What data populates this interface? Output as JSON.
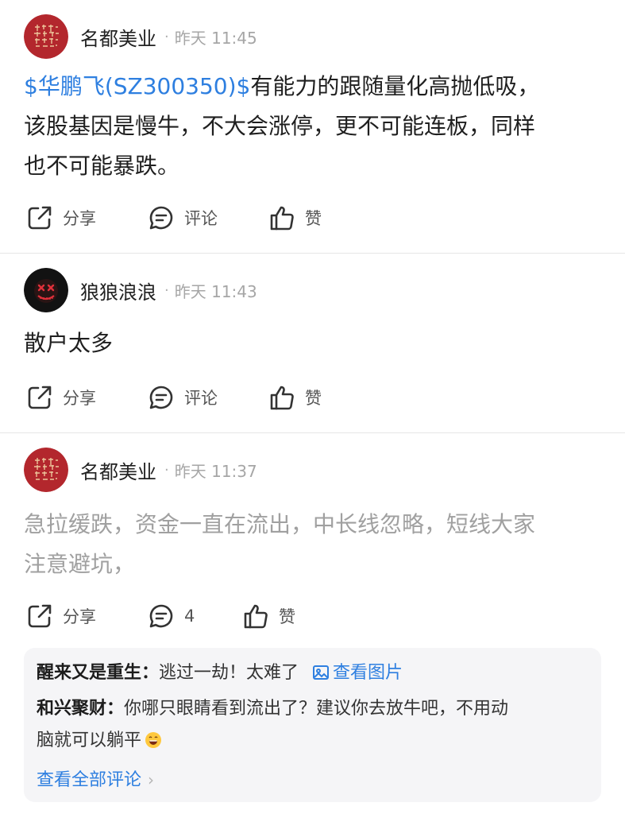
{
  "posts": [
    {
      "user": "名都美业",
      "dot": "·",
      "time": "昨天 11:45",
      "stock": "$华鹏飞(SZ300350)$",
      "text_line1": "有能力的跟随量化高抛低吸，",
      "text_line2": "该股基因是慢牛，不大会涨停，更不可能连板，同样",
      "text_line3": "也不可能暴跌。",
      "share_label": "分享",
      "comment_label": "评论",
      "like_label": "赞"
    },
    {
      "user": "狼狼浪浪",
      "dot": "·",
      "time": "昨天 11:43",
      "text_line1": "散户太多",
      "share_label": "分享",
      "comment_label": "评论",
      "like_label": "赞"
    },
    {
      "user": "名都美业",
      "dot": "·",
      "time": "昨天 11:37",
      "text_line1": "急拉缓跌，资金一直在流出，中长线忽略，短线大家",
      "text_line2": "注意避坑，",
      "share_label": "分享",
      "comment_count": "4",
      "like_label": "赞",
      "replies": [
        {
          "name": "醒来又是重生：",
          "text": "逃过一劫！太难了",
          "link": "查看图片"
        },
        {
          "name": "和兴聚财：",
          "text_line1": "你哪只眼睛看到流出了？建议你去放牛吧，不用动",
          "text_line2": "脑就可以躺平"
        }
      ],
      "view_all": "查看全部评论",
      "view_all_chevron": "›"
    }
  ],
  "icons": {
    "share": "share-icon",
    "comment": "comment-icon",
    "like": "thumbs-up-icon",
    "image": "image-icon",
    "emoji": "grinning-emoji"
  },
  "colors": {
    "link_blue": "#2e7fe0",
    "seal_red": "#b3272d",
    "muted_text": "#a0a0a0"
  }
}
